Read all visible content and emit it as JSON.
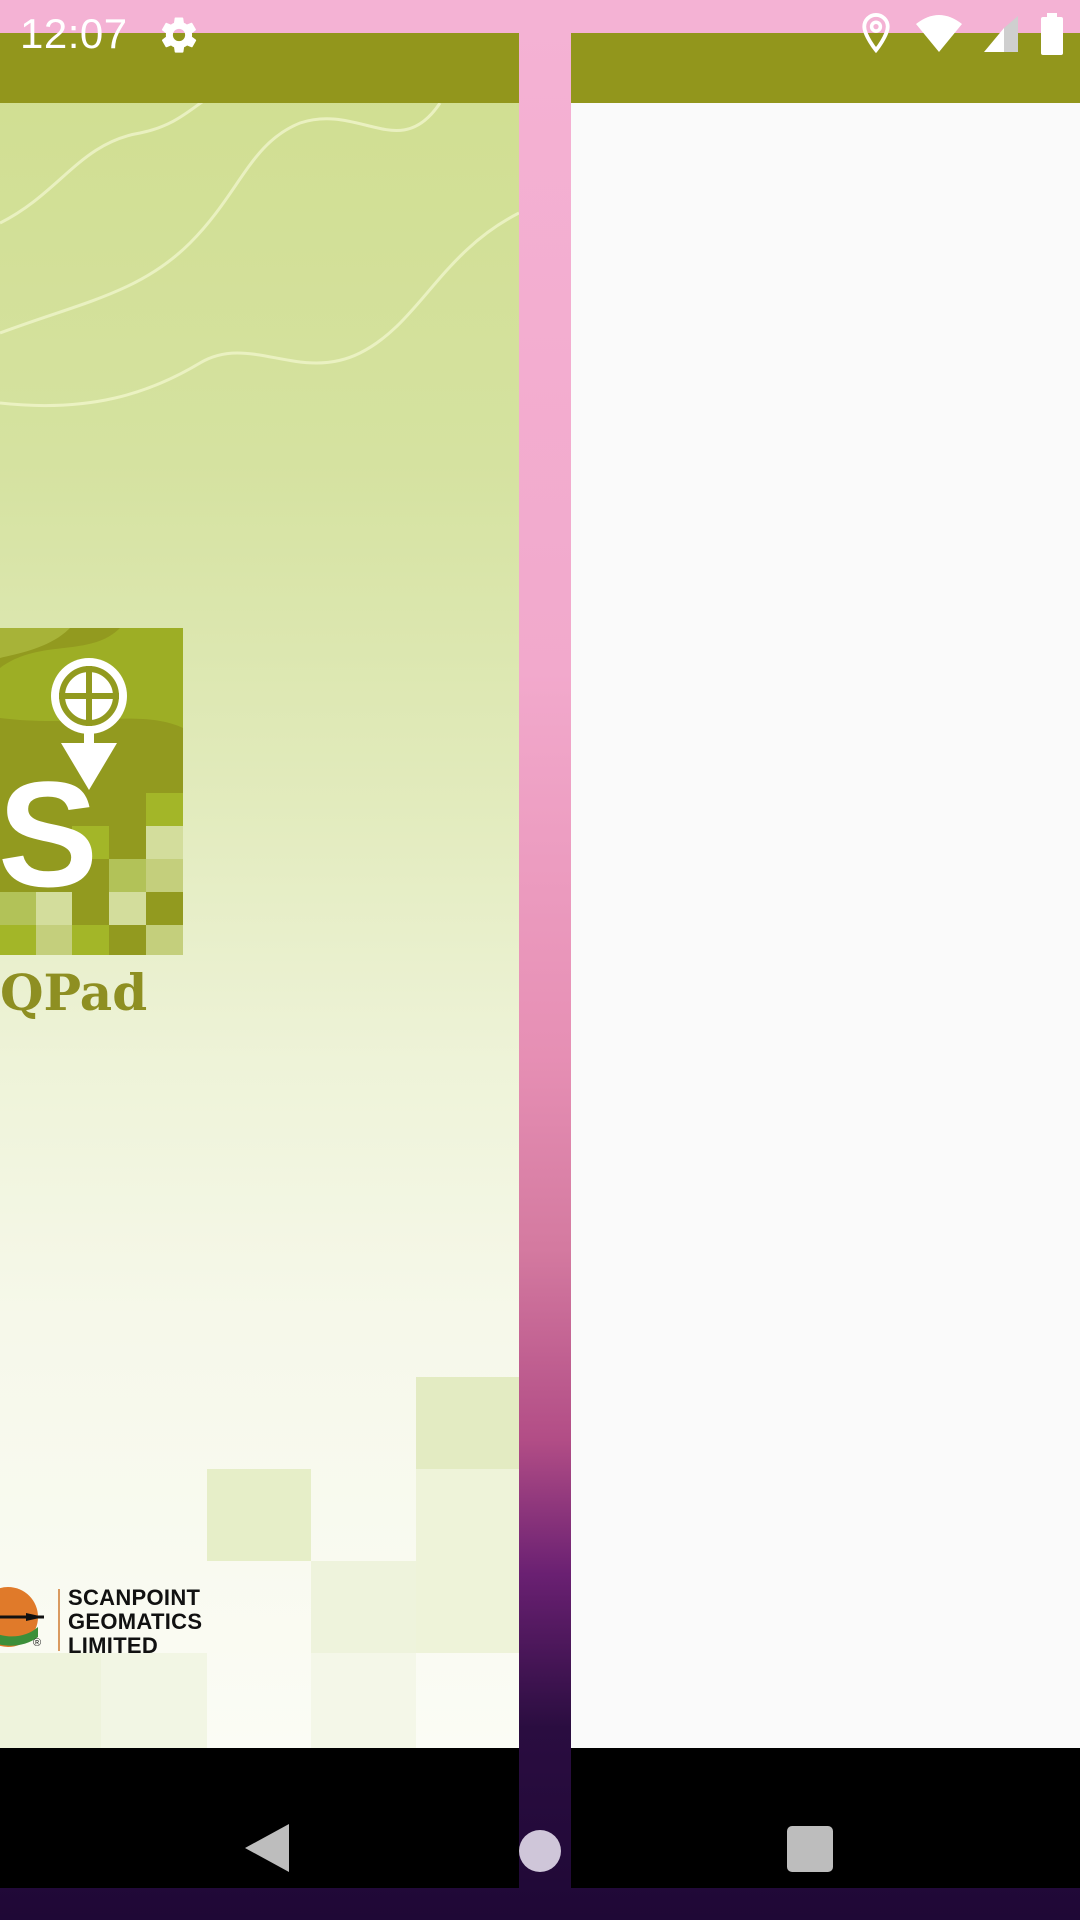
{
  "status_bar": {
    "time": "12:07",
    "icons": [
      "gear-icon",
      "location-icon",
      "wifi-icon",
      "cell-signal-icon",
      "battery-icon"
    ]
  },
  "left_window": {
    "app_name": "QPad",
    "company": {
      "line1": "SCANPOINT",
      "line2": "GEOMATICS",
      "line3": "LIMITED",
      "registered_mark": "®"
    }
  },
  "nav_bar": {
    "buttons": [
      "back-icon",
      "home-icon",
      "recents-icon"
    ]
  },
  "colors": {
    "app_bar": "#92961c",
    "logo_olive": "#929a1f",
    "logo_lime": "#a3b628",
    "right_pane": "#fafafa"
  }
}
